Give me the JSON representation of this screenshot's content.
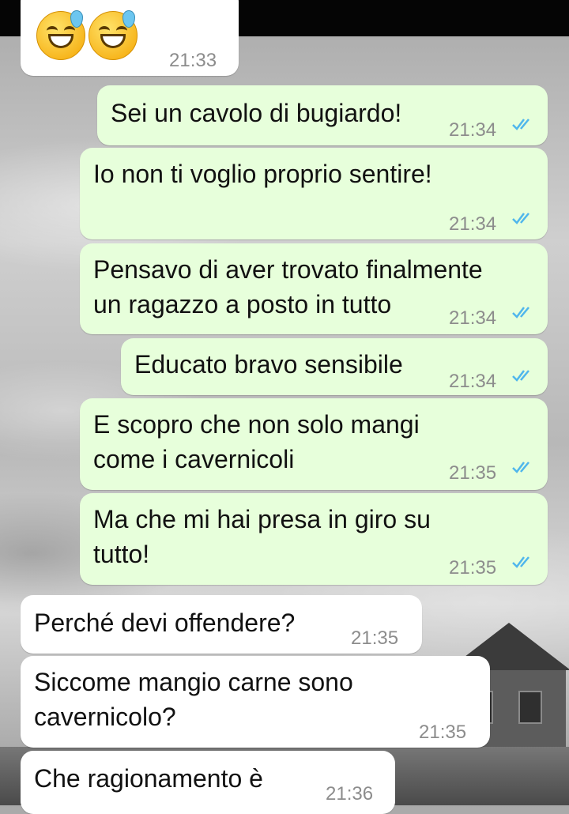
{
  "colors": {
    "incoming_bubble": "#ffffff",
    "outgoing_bubble": "#e7ffdb",
    "time_text": "#8c8c8c",
    "read_ticks": "#4fb6ec"
  },
  "messages": [
    {
      "id": "m0",
      "side": "in",
      "content": "😅😅",
      "emoji_icons": [
        "grinning-face-with-sweat-icon",
        "grinning-face-with-sweat-icon"
      ],
      "time": "21:33"
    },
    {
      "id": "m1",
      "side": "out",
      "content": "Sei un cavolo di bugiardo!",
      "time": "21:34",
      "status": "read"
    },
    {
      "id": "m2",
      "side": "out",
      "content": "Io non ti voglio proprio sentire!",
      "time": "21:34",
      "status": "read"
    },
    {
      "id": "m3",
      "side": "out",
      "content": "Pensavo di aver trovato finalmente un ragazzo a posto in tutto",
      "time": "21:34",
      "status": "read"
    },
    {
      "id": "m4",
      "side": "out",
      "content": "Educato bravo sensibile",
      "time": "21:34",
      "status": "read"
    },
    {
      "id": "m5",
      "side": "out",
      "content": "E scopro che non solo mangi come i cavernicoli",
      "time": "21:35",
      "status": "read"
    },
    {
      "id": "m6",
      "side": "out",
      "content": "Ma che mi hai presa in giro su tutto!",
      "time": "21:35",
      "status": "read"
    },
    {
      "id": "m7",
      "side": "in",
      "content": "Perché devi offendere?",
      "time": "21:35"
    },
    {
      "id": "m8",
      "side": "in",
      "content": "Siccome mangio carne sono cavernicolo?",
      "time": "21:35"
    },
    {
      "id": "m9",
      "side": "in",
      "content": "Che ragionamento è",
      "time": "21:36"
    }
  ],
  "message_lines": {
    "m1": [
      "Sei un cavolo di bugiardo!"
    ],
    "m2": [
      "Io non ti voglio proprio sentire!"
    ],
    "m3": [
      "Pensavo di aver trovato finalmente",
      "un ragazzo a posto in tutto"
    ],
    "m4": [
      "Educato bravo sensibile"
    ],
    "m5": [
      "E scopro che non solo mangi",
      "come i cavernicoli"
    ],
    "m6": [
      "Ma che mi hai presa in giro su",
      "tutto!"
    ],
    "m7": [
      "Perché devi offendere?"
    ],
    "m8": [
      "Siccome mangio carne sono",
      "cavernicolo?"
    ],
    "m9": [
      "Che ragionamento è"
    ]
  }
}
